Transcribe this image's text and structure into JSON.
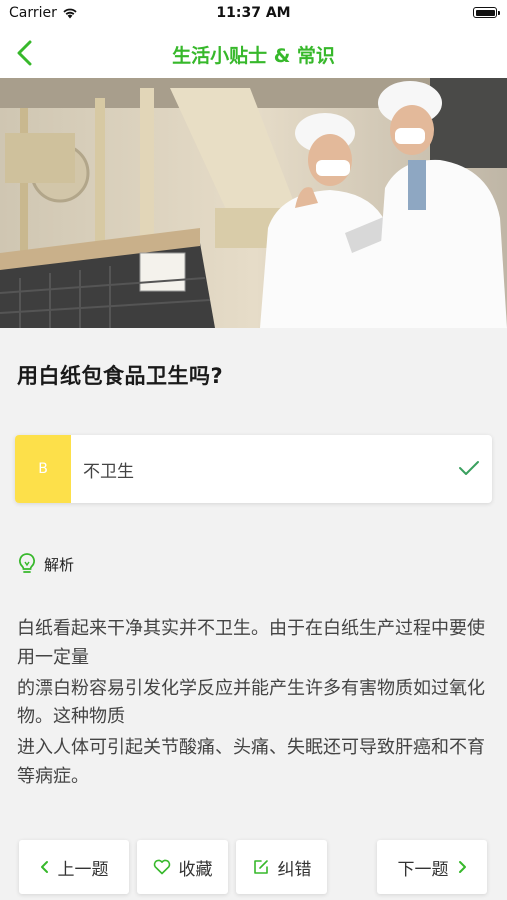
{
  "status_bar": {
    "carrier": "Carrier",
    "time": "11:37 AM",
    "battery_level": 1.0
  },
  "nav": {
    "title": "生活小贴士 & 常识",
    "back_icon": "chevron-left-icon"
  },
  "hero": {
    "alt_kind": "photo"
  },
  "question": {
    "text": "用白纸包食品卫生吗?"
  },
  "answer": {
    "letter": "B",
    "text": "不卫生",
    "correct": true,
    "accent": "#fde04a",
    "check_color": "#3aa05f"
  },
  "analysis": {
    "label": "解析",
    "icon": "lightbulb-icon",
    "paragraphs": [
      "白纸看起来干净其实并不卫生。由于在白纸生产过程中要使用一定量",
      "的漂白粉容易引发化学反应并能产生许多有害物质如过氧化物。这种物质",
      "进入人体可引起关节酸痛、头痛、失眠还可导致肝癌和不育等病症。"
    ]
  },
  "toolbar": {
    "prev_label": "上一题",
    "favorite_label": "收藏",
    "correct_label": "纠错",
    "next_label": "下一题"
  },
  "colors": {
    "brand_green": "#37b82b"
  }
}
